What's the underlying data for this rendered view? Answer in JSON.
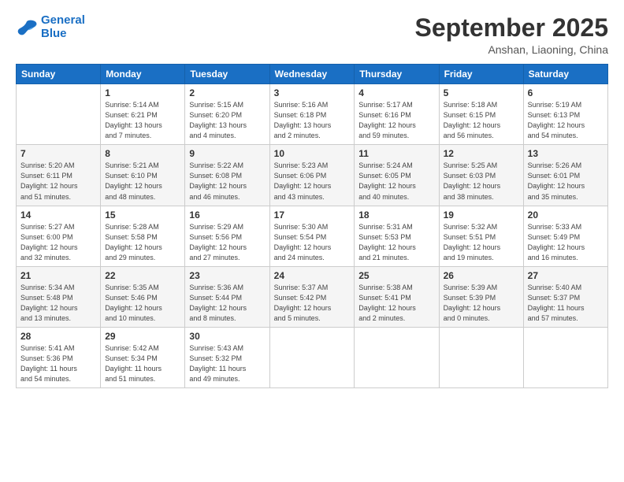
{
  "logo": {
    "line1": "General",
    "line2": "Blue"
  },
  "title": "September 2025",
  "subtitle": "Anshan, Liaoning, China",
  "days_header": [
    "Sunday",
    "Monday",
    "Tuesday",
    "Wednesday",
    "Thursday",
    "Friday",
    "Saturday"
  ],
  "weeks": [
    [
      {
        "day": "",
        "info": ""
      },
      {
        "day": "1",
        "info": "Sunrise: 5:14 AM\nSunset: 6:21 PM\nDaylight: 13 hours\nand 7 minutes."
      },
      {
        "day": "2",
        "info": "Sunrise: 5:15 AM\nSunset: 6:20 PM\nDaylight: 13 hours\nand 4 minutes."
      },
      {
        "day": "3",
        "info": "Sunrise: 5:16 AM\nSunset: 6:18 PM\nDaylight: 13 hours\nand 2 minutes."
      },
      {
        "day": "4",
        "info": "Sunrise: 5:17 AM\nSunset: 6:16 PM\nDaylight: 12 hours\nand 59 minutes."
      },
      {
        "day": "5",
        "info": "Sunrise: 5:18 AM\nSunset: 6:15 PM\nDaylight: 12 hours\nand 56 minutes."
      },
      {
        "day": "6",
        "info": "Sunrise: 5:19 AM\nSunset: 6:13 PM\nDaylight: 12 hours\nand 54 minutes."
      }
    ],
    [
      {
        "day": "7",
        "info": "Sunrise: 5:20 AM\nSunset: 6:11 PM\nDaylight: 12 hours\nand 51 minutes."
      },
      {
        "day": "8",
        "info": "Sunrise: 5:21 AM\nSunset: 6:10 PM\nDaylight: 12 hours\nand 48 minutes."
      },
      {
        "day": "9",
        "info": "Sunrise: 5:22 AM\nSunset: 6:08 PM\nDaylight: 12 hours\nand 46 minutes."
      },
      {
        "day": "10",
        "info": "Sunrise: 5:23 AM\nSunset: 6:06 PM\nDaylight: 12 hours\nand 43 minutes."
      },
      {
        "day": "11",
        "info": "Sunrise: 5:24 AM\nSunset: 6:05 PM\nDaylight: 12 hours\nand 40 minutes."
      },
      {
        "day": "12",
        "info": "Sunrise: 5:25 AM\nSunset: 6:03 PM\nDaylight: 12 hours\nand 38 minutes."
      },
      {
        "day": "13",
        "info": "Sunrise: 5:26 AM\nSunset: 6:01 PM\nDaylight: 12 hours\nand 35 minutes."
      }
    ],
    [
      {
        "day": "14",
        "info": "Sunrise: 5:27 AM\nSunset: 6:00 PM\nDaylight: 12 hours\nand 32 minutes."
      },
      {
        "day": "15",
        "info": "Sunrise: 5:28 AM\nSunset: 5:58 PM\nDaylight: 12 hours\nand 29 minutes."
      },
      {
        "day": "16",
        "info": "Sunrise: 5:29 AM\nSunset: 5:56 PM\nDaylight: 12 hours\nand 27 minutes."
      },
      {
        "day": "17",
        "info": "Sunrise: 5:30 AM\nSunset: 5:54 PM\nDaylight: 12 hours\nand 24 minutes."
      },
      {
        "day": "18",
        "info": "Sunrise: 5:31 AM\nSunset: 5:53 PM\nDaylight: 12 hours\nand 21 minutes."
      },
      {
        "day": "19",
        "info": "Sunrise: 5:32 AM\nSunset: 5:51 PM\nDaylight: 12 hours\nand 19 minutes."
      },
      {
        "day": "20",
        "info": "Sunrise: 5:33 AM\nSunset: 5:49 PM\nDaylight: 12 hours\nand 16 minutes."
      }
    ],
    [
      {
        "day": "21",
        "info": "Sunrise: 5:34 AM\nSunset: 5:48 PM\nDaylight: 12 hours\nand 13 minutes."
      },
      {
        "day": "22",
        "info": "Sunrise: 5:35 AM\nSunset: 5:46 PM\nDaylight: 12 hours\nand 10 minutes."
      },
      {
        "day": "23",
        "info": "Sunrise: 5:36 AM\nSunset: 5:44 PM\nDaylight: 12 hours\nand 8 minutes."
      },
      {
        "day": "24",
        "info": "Sunrise: 5:37 AM\nSunset: 5:42 PM\nDaylight: 12 hours\nand 5 minutes."
      },
      {
        "day": "25",
        "info": "Sunrise: 5:38 AM\nSunset: 5:41 PM\nDaylight: 12 hours\nand 2 minutes."
      },
      {
        "day": "26",
        "info": "Sunrise: 5:39 AM\nSunset: 5:39 PM\nDaylight: 12 hours\nand 0 minutes."
      },
      {
        "day": "27",
        "info": "Sunrise: 5:40 AM\nSunset: 5:37 PM\nDaylight: 11 hours\nand 57 minutes."
      }
    ],
    [
      {
        "day": "28",
        "info": "Sunrise: 5:41 AM\nSunset: 5:36 PM\nDaylight: 11 hours\nand 54 minutes."
      },
      {
        "day": "29",
        "info": "Sunrise: 5:42 AM\nSunset: 5:34 PM\nDaylight: 11 hours\nand 51 minutes."
      },
      {
        "day": "30",
        "info": "Sunrise: 5:43 AM\nSunset: 5:32 PM\nDaylight: 11 hours\nand 49 minutes."
      },
      {
        "day": "",
        "info": ""
      },
      {
        "day": "",
        "info": ""
      },
      {
        "day": "",
        "info": ""
      },
      {
        "day": "",
        "info": ""
      }
    ]
  ]
}
